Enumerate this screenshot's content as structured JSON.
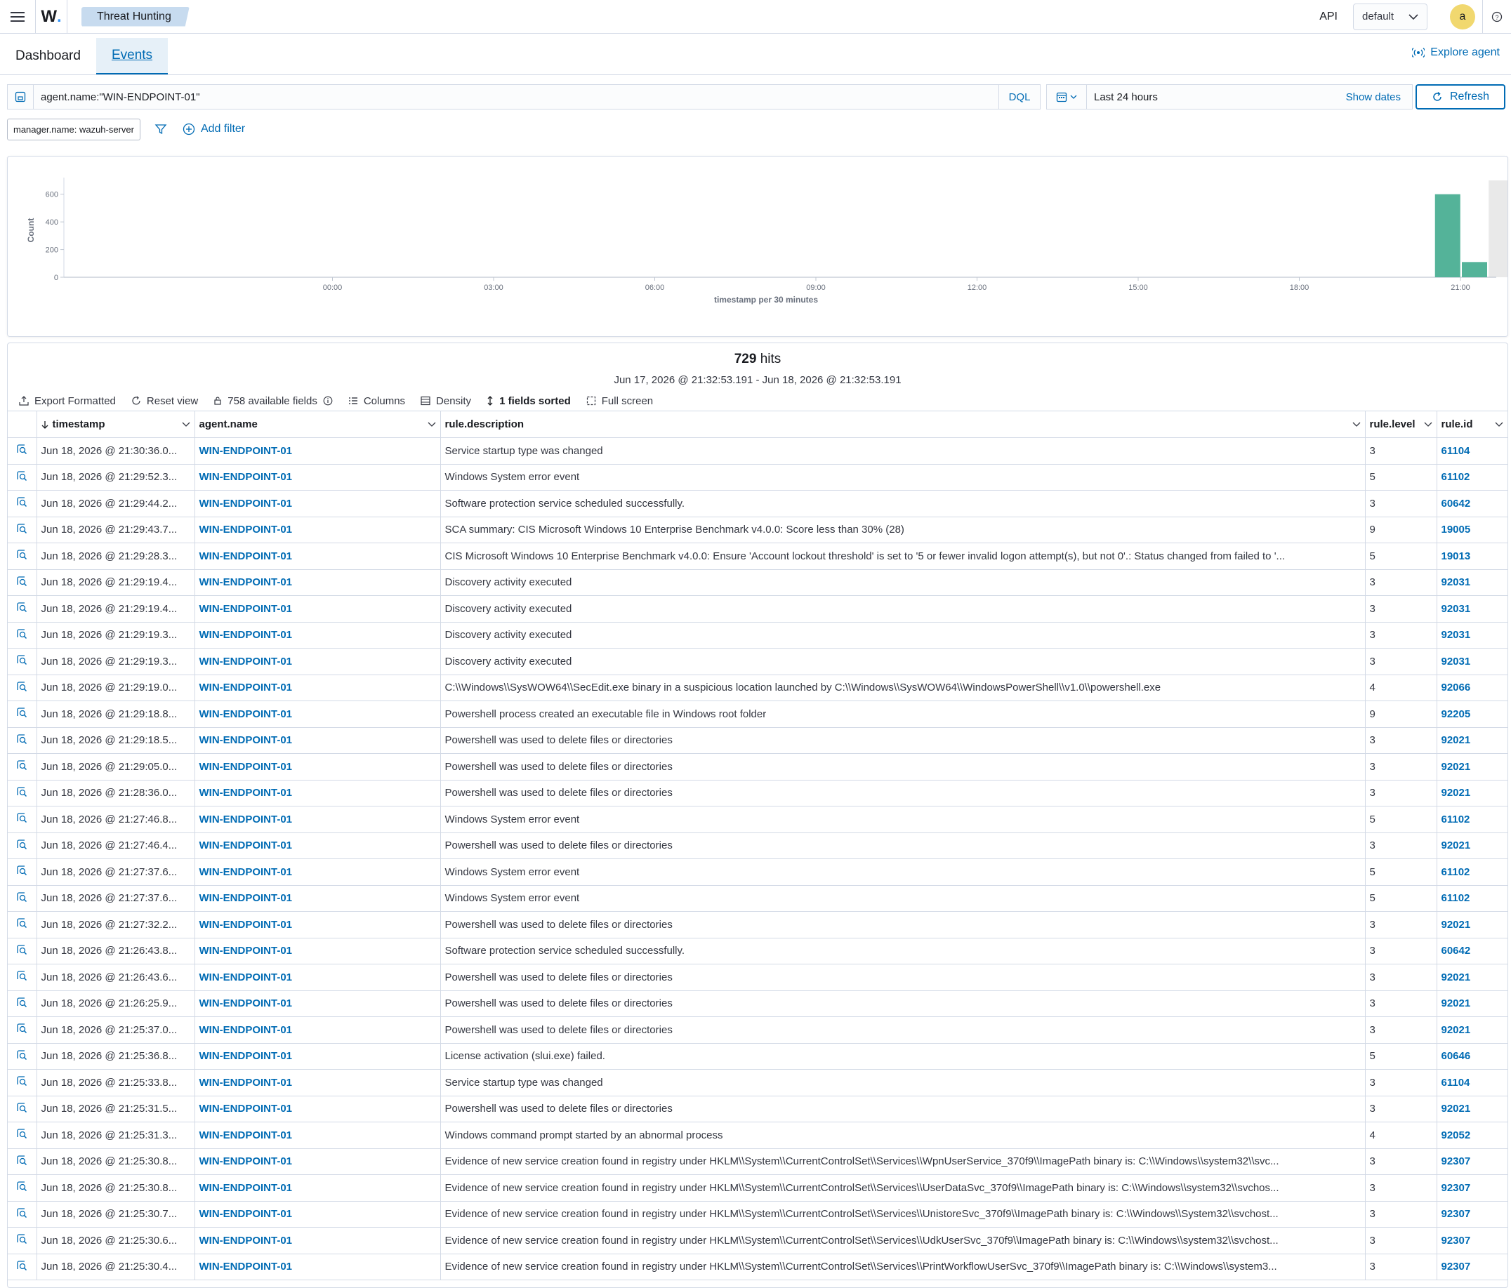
{
  "header": {
    "breadcrumb": "Threat Hunting",
    "api_label": "API",
    "tenant": "default",
    "avatar": "a"
  },
  "tabs": [
    {
      "label": "Dashboard",
      "active": false
    },
    {
      "label": "Events",
      "active": true
    }
  ],
  "explore_agent": "Explore agent",
  "query": {
    "value": "agent.name:\"WIN-ENDPOINT-01\"",
    "language": "DQL",
    "time_range": "Last 24 hours",
    "show_dates": "Show dates",
    "refresh": "Refresh"
  },
  "filters": {
    "pill": "manager.name: wazuh-server",
    "add_filter": "Add filter"
  },
  "chart_data": {
    "type": "bar",
    "xlabel": "timestamp per 30 minutes",
    "ylabel": "Count",
    "yticks": [
      0,
      200,
      400,
      600
    ],
    "ylim": [
      0,
      700
    ],
    "xticks": [
      "00:00",
      "03:00",
      "06:00",
      "09:00",
      "12:00",
      "15:00",
      "18:00",
      "21:00"
    ],
    "series": [
      {
        "x": [
          "20:30",
          "21:00"
        ],
        "values": [
          600,
          110
        ],
        "color": "#54b399"
      }
    ],
    "highlight": {
      "from": "21:30",
      "color": "#e9e9e9"
    },
    "grid": false
  },
  "results": {
    "hits_count": "729",
    "hits_label": "hits",
    "range": "Jun 17, 2026 @ 21:32:53.191 - Jun 18, 2026 @ 21:32:53.191",
    "toolbar": {
      "export": "Export Formatted",
      "reset": "Reset view",
      "fields": "758 available fields",
      "columns": "Columns",
      "density": "Density",
      "sorted": "1 fields sorted",
      "fullscreen": "Full screen"
    },
    "columns": [
      "timestamp",
      "agent.name",
      "rule.description",
      "rule.level",
      "rule.id"
    ],
    "rows": [
      [
        "Jun 18, 2026 @ 21:30:36.0...",
        "WIN-ENDPOINT-01",
        "Service startup type was changed",
        "3",
        "61104"
      ],
      [
        "Jun 18, 2026 @ 21:29:52.3...",
        "WIN-ENDPOINT-01",
        "Windows System error event",
        "5",
        "61102"
      ],
      [
        "Jun 18, 2026 @ 21:29:44.2...",
        "WIN-ENDPOINT-01",
        "Software protection service scheduled successfully.",
        "3",
        "60642"
      ],
      [
        "Jun 18, 2026 @ 21:29:43.7...",
        "WIN-ENDPOINT-01",
        "SCA summary: CIS Microsoft Windows 10 Enterprise Benchmark v4.0.0: Score less than 30% (28)",
        "9",
        "19005"
      ],
      [
        "Jun 18, 2026 @ 21:29:28.3...",
        "WIN-ENDPOINT-01",
        "CIS Microsoft Windows 10 Enterprise Benchmark v4.0.0: Ensure 'Account lockout threshold' is set to '5 or fewer invalid logon attempt(s), but not 0'.: Status changed from failed to '...",
        "5",
        "19013"
      ],
      [
        "Jun 18, 2026 @ 21:29:19.4...",
        "WIN-ENDPOINT-01",
        "Discovery activity executed",
        "3",
        "92031"
      ],
      [
        "Jun 18, 2026 @ 21:29:19.4...",
        "WIN-ENDPOINT-01",
        "Discovery activity executed",
        "3",
        "92031"
      ],
      [
        "Jun 18, 2026 @ 21:29:19.3...",
        "WIN-ENDPOINT-01",
        "Discovery activity executed",
        "3",
        "92031"
      ],
      [
        "Jun 18, 2026 @ 21:29:19.3...",
        "WIN-ENDPOINT-01",
        "Discovery activity executed",
        "3",
        "92031"
      ],
      [
        "Jun 18, 2026 @ 21:29:19.0...",
        "WIN-ENDPOINT-01",
        "C:\\\\Windows\\\\SysWOW64\\\\SecEdit.exe binary in a suspicious location launched by C:\\\\Windows\\\\SysWOW64\\\\WindowsPowerShell\\\\v1.0\\\\powershell.exe",
        "4",
        "92066"
      ],
      [
        "Jun 18, 2026 @ 21:29:18.8...",
        "WIN-ENDPOINT-01",
        "Powershell process created an executable file in Windows root folder",
        "9",
        "92205"
      ],
      [
        "Jun 18, 2026 @ 21:29:18.5...",
        "WIN-ENDPOINT-01",
        "Powershell was used to delete files or directories",
        "3",
        "92021"
      ],
      [
        "Jun 18, 2026 @ 21:29:05.0...",
        "WIN-ENDPOINT-01",
        "Powershell was used to delete files or directories",
        "3",
        "92021"
      ],
      [
        "Jun 18, 2026 @ 21:28:36.0...",
        "WIN-ENDPOINT-01",
        "Powershell was used to delete files or directories",
        "3",
        "92021"
      ],
      [
        "Jun 18, 2026 @ 21:27:46.8...",
        "WIN-ENDPOINT-01",
        "Windows System error event",
        "5",
        "61102"
      ],
      [
        "Jun 18, 2026 @ 21:27:46.4...",
        "WIN-ENDPOINT-01",
        "Powershell was used to delete files or directories",
        "3",
        "92021"
      ],
      [
        "Jun 18, 2026 @ 21:27:37.6...",
        "WIN-ENDPOINT-01",
        "Windows System error event",
        "5",
        "61102"
      ],
      [
        "Jun 18, 2026 @ 21:27:37.6...",
        "WIN-ENDPOINT-01",
        "Windows System error event",
        "5",
        "61102"
      ],
      [
        "Jun 18, 2026 @ 21:27:32.2...",
        "WIN-ENDPOINT-01",
        "Powershell was used to delete files or directories",
        "3",
        "92021"
      ],
      [
        "Jun 18, 2026 @ 21:26:43.8...",
        "WIN-ENDPOINT-01",
        "Software protection service scheduled successfully.",
        "3",
        "60642"
      ],
      [
        "Jun 18, 2026 @ 21:26:43.6...",
        "WIN-ENDPOINT-01",
        "Powershell was used to delete files or directories",
        "3",
        "92021"
      ],
      [
        "Jun 18, 2026 @ 21:26:25.9...",
        "WIN-ENDPOINT-01",
        "Powershell was used to delete files or directories",
        "3",
        "92021"
      ],
      [
        "Jun 18, 2026 @ 21:25:37.0...",
        "WIN-ENDPOINT-01",
        "Powershell was used to delete files or directories",
        "3",
        "92021"
      ],
      [
        "Jun 18, 2026 @ 21:25:36.8...",
        "WIN-ENDPOINT-01",
        "License activation (slui.exe) failed.",
        "5",
        "60646"
      ],
      [
        "Jun 18, 2026 @ 21:25:33.8...",
        "WIN-ENDPOINT-01",
        "Service startup type was changed",
        "3",
        "61104"
      ],
      [
        "Jun 18, 2026 @ 21:25:31.5...",
        "WIN-ENDPOINT-01",
        "Powershell was used to delete files or directories",
        "3",
        "92021"
      ],
      [
        "Jun 18, 2026 @ 21:25:31.3...",
        "WIN-ENDPOINT-01",
        "Windows command prompt started by an abnormal process",
        "4",
        "92052"
      ],
      [
        "Jun 18, 2026 @ 21:25:30.8...",
        "WIN-ENDPOINT-01",
        "Evidence of new service creation found in registry under HKLM\\\\System\\\\CurrentControlSet\\\\Services\\\\WpnUserService_370f9\\\\ImagePath binary is: C:\\\\Windows\\\\system32\\\\svc...",
        "3",
        "92307"
      ],
      [
        "Jun 18, 2026 @ 21:25:30.8...",
        "WIN-ENDPOINT-01",
        "Evidence of new service creation found in registry under HKLM\\\\System\\\\CurrentControlSet\\\\Services\\\\UserDataSvc_370f9\\\\ImagePath binary is: C:\\\\Windows\\\\system32\\\\svchos...",
        "3",
        "92307"
      ],
      [
        "Jun 18, 2026 @ 21:25:30.7...",
        "WIN-ENDPOINT-01",
        "Evidence of new service creation found in registry under HKLM\\\\System\\\\CurrentControlSet\\\\Services\\\\UnistoreSvc_370f9\\\\ImagePath binary is: C:\\\\Windows\\\\System32\\\\svchost...",
        "3",
        "92307"
      ],
      [
        "Jun 18, 2026 @ 21:25:30.6...",
        "WIN-ENDPOINT-01",
        "Evidence of new service creation found in registry under HKLM\\\\System\\\\CurrentControlSet\\\\Services\\\\UdkUserSvc_370f9\\\\ImagePath binary is: C:\\\\Windows\\\\system32\\\\svchost...",
        "3",
        "92307"
      ],
      [
        "Jun 18, 2026 @ 21:25:30.4...",
        "WIN-ENDPOINT-01",
        "Evidence of new service creation found in registry under HKLM\\\\System\\\\CurrentControlSet\\\\Services\\\\PrintWorkflowUserSvc_370f9\\\\ImagePath binary is: C:\\\\Windows\\\\system3...",
        "3",
        "92307"
      ]
    ]
  }
}
